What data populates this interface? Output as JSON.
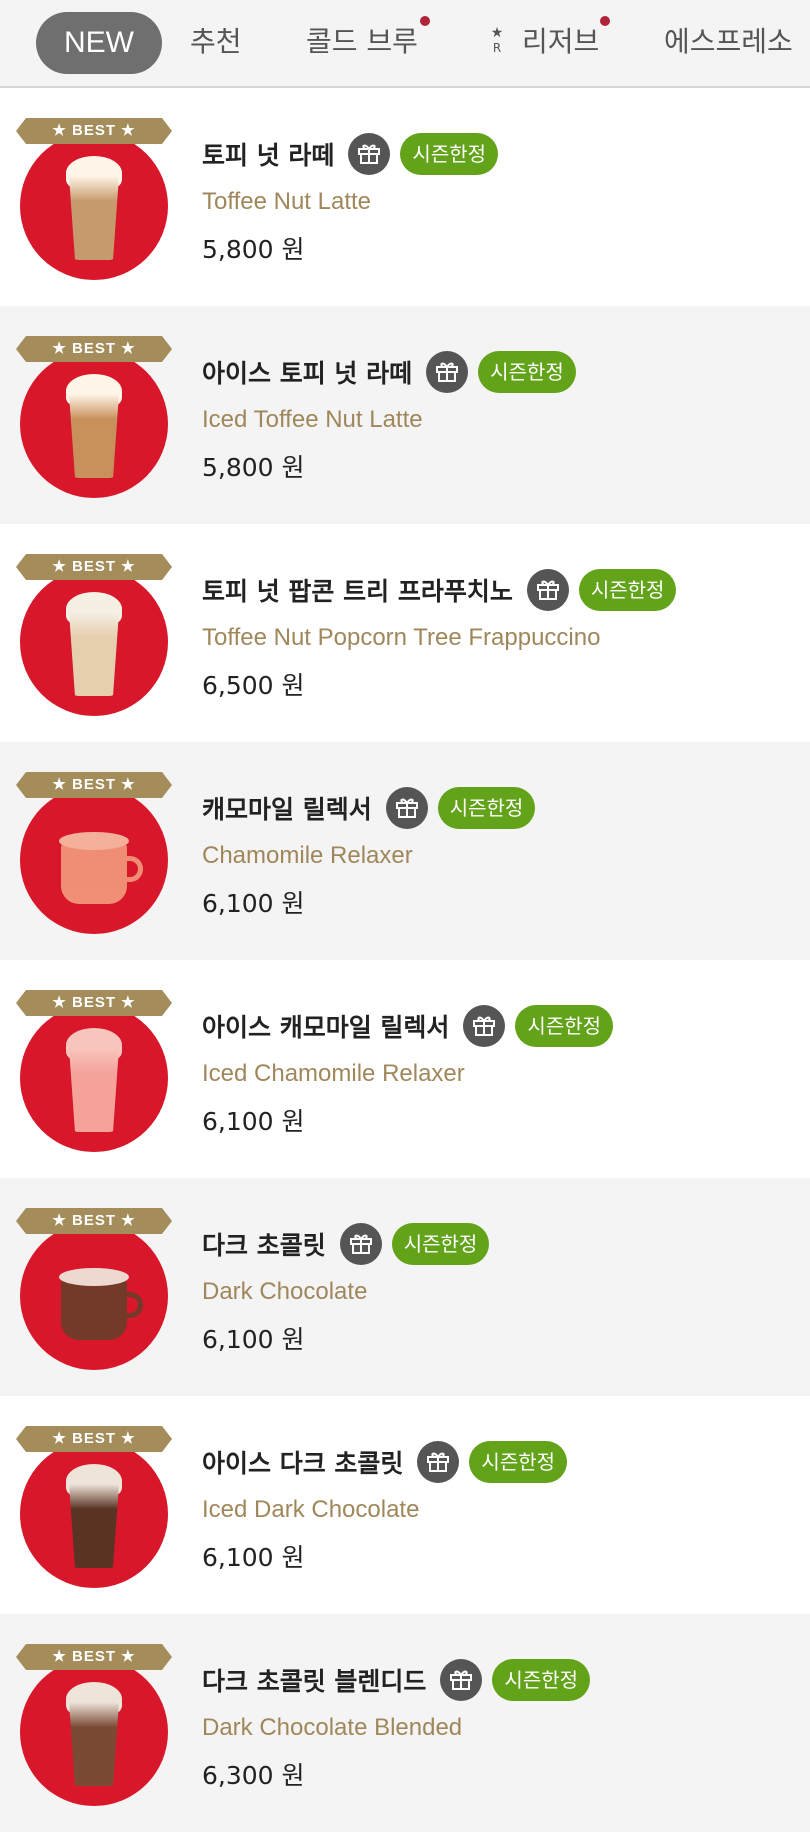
{
  "tabs": [
    {
      "label": "NEW",
      "active": true,
      "dot": false
    },
    {
      "label": "추천",
      "active": false,
      "dot": false
    },
    {
      "label": "콜드 브루",
      "active": false,
      "dot": true
    },
    {
      "label": "리저브",
      "active": false,
      "dot": true,
      "icon": "reserve-star-icon",
      "icon_glyph": "★",
      "icon_letter": "R"
    },
    {
      "label": "에스프레소",
      "active": false,
      "dot": false
    }
  ],
  "items": [
    {
      "best": "★ BEST ★",
      "name_ko": "토피 넛 라떼",
      "badge": "시즌한정",
      "name_en": "Toffee Nut Latte",
      "price": "5,800 원",
      "drink": "hot-cream"
    },
    {
      "best": "★ BEST ★",
      "name_ko": "아이스 토피 넛 라떼",
      "badge": "시즌한정",
      "name_en": "Iced Toffee Nut Latte",
      "price": "5,800 원",
      "drink": "iced-cream"
    },
    {
      "best": "★ BEST ★",
      "name_ko": "토피 넛 팝콘 트리 프라푸치노",
      "badge": "시즌한정",
      "name_en": "Toffee Nut Popcorn Tree Frappuccino",
      "price": "6,500 원",
      "drink": "frap"
    },
    {
      "best": "★ BEST ★",
      "name_ko": "캐모마일 릴렉서",
      "badge": "시즌한정",
      "name_en": "Chamomile Relaxer",
      "price": "6,100 원",
      "drink": "mug-pink"
    },
    {
      "best": "★ BEST ★",
      "name_ko": "아이스 캐모마일 릴렉서",
      "badge": "시즌한정",
      "name_en": "Iced Chamomile Relaxer",
      "price": "6,100 원",
      "drink": "iced-pink"
    },
    {
      "best": "★ BEST ★",
      "name_ko": "다크 초콜릿",
      "badge": "시즌한정",
      "name_en": "Dark Chocolate",
      "price": "6,100 원",
      "drink": "mug-choc"
    },
    {
      "best": "★ BEST ★",
      "name_ko": "아이스 다크 초콜릿",
      "badge": "시즌한정",
      "name_en": "Iced Dark Chocolate",
      "price": "6,100 원",
      "drink": "iced-choc"
    },
    {
      "best": "★ BEST ★",
      "name_ko": "다크 초콜릿 블렌디드",
      "badge": "시즌한정",
      "name_en": "Dark Chocolate Blended",
      "price": "6,300 원",
      "drink": "blended-choc"
    }
  ],
  "colors": {
    "best_ribbon": "#a58d5b",
    "season_badge": "#62a31a",
    "thumb_bg": "#d8172b",
    "english_name": "#a0875b",
    "tab_dot": "#b0243a"
  }
}
